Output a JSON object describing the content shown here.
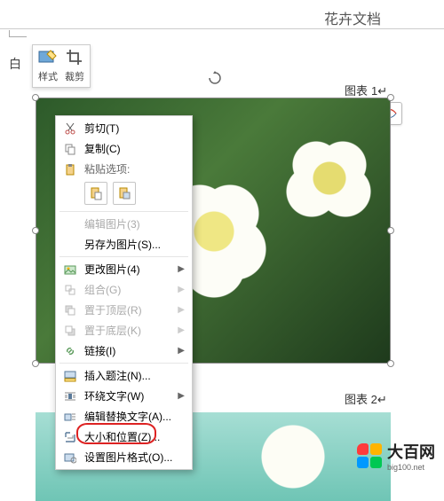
{
  "doc": {
    "title": "花卉文档"
  },
  "sideLabel": "白",
  "floatTool": {
    "style": "样式",
    "crop": "裁剪"
  },
  "captions": {
    "c1_label": "图表",
    "c1_num": "1",
    "c2_label": "图表",
    "c2_num": "2"
  },
  "menu": {
    "cut": "剪切(T)",
    "copy": "复制(C)",
    "pasteHeader": "粘贴选项:",
    "editPic": "编辑图片(3)",
    "saveAs": "另存为图片(S)...",
    "changePic": "更改图片(4)",
    "group": "组合(G)",
    "bringFront": "置于顶层(R)",
    "sendBack": "置于底层(K)",
    "link": "链接(I)",
    "insertCaption": "插入题注(N)...",
    "wrapText": "环绕文字(W)",
    "altText": "编辑替换文字(A)...",
    "sizePos": "大小和位置(Z)...",
    "format": "设置图片格式(O)..."
  },
  "watermark": {
    "text": "大百网",
    "url": "big100.net"
  }
}
